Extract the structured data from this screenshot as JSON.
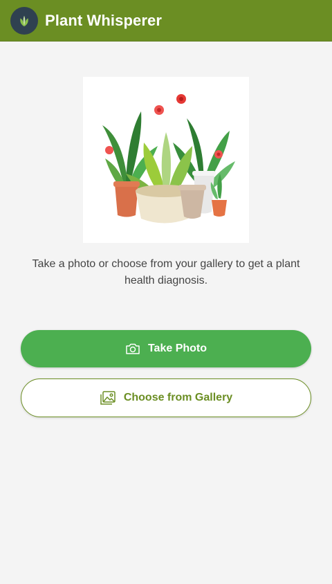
{
  "app": {
    "title": "Plant Whisperer",
    "colors": {
      "app_bar": "#6b8e23",
      "primary": "#4caf50",
      "secondary_text": "#6b8e23",
      "background": "#f4f4f4"
    }
  },
  "header": {
    "logo_icon": "leaf-icon",
    "title": "Plant Whisperer"
  },
  "hero": {
    "image_description": "potted-plants-illustration"
  },
  "main": {
    "instructions": "Take a photo or choose from your gallery to get a plant health diagnosis."
  },
  "actions": {
    "take_photo": {
      "label": "Take Photo",
      "icon": "camera-icon"
    },
    "choose_gallery": {
      "label": "Choose from Gallery",
      "icon": "image-gallery-icon"
    }
  }
}
